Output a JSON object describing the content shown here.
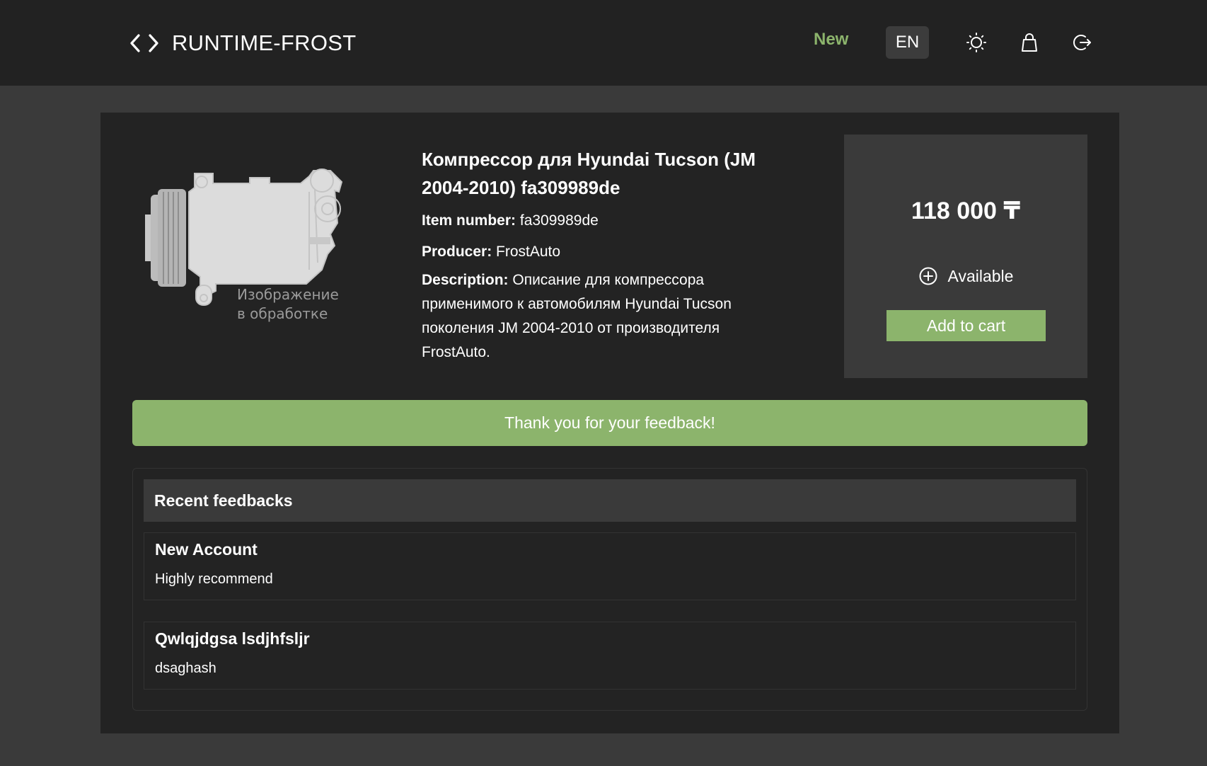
{
  "header": {
    "brand": "RUNTIME-FROST",
    "nav_new": "New",
    "lang": "EN"
  },
  "product": {
    "image_caption": "Изображение в обработке",
    "title": "Компрессор для Hyundai Tucson (JM 2004-2010) fa309989de",
    "item_number_label": "Item number:",
    "item_number": "fa309989de",
    "producer_label": "Producer:",
    "producer": "FrostAuto",
    "description_label": "Description:",
    "description": "Описание для компрессора применимого к автомобилям Hyundai Tucson поколения JM 2004-2010 от производителя FrostAuto."
  },
  "purchase": {
    "price": "118 000 ₸",
    "availability": "Available",
    "add_to_cart": "Add to cart"
  },
  "alert": {
    "message": "Thank you for your feedback!"
  },
  "feedbacks": {
    "title": "Recent feedbacks",
    "items": [
      {
        "name": "New Account",
        "text": "Highly recommend"
      },
      {
        "name": "Qwlqjdgsa lsdjhfsljr",
        "text": "dsaghash"
      }
    ]
  },
  "colors": {
    "accent": "#8cb46c",
    "header_bg": "#222222",
    "page_bg": "#3a3a3a",
    "card_bg": "#232323"
  }
}
